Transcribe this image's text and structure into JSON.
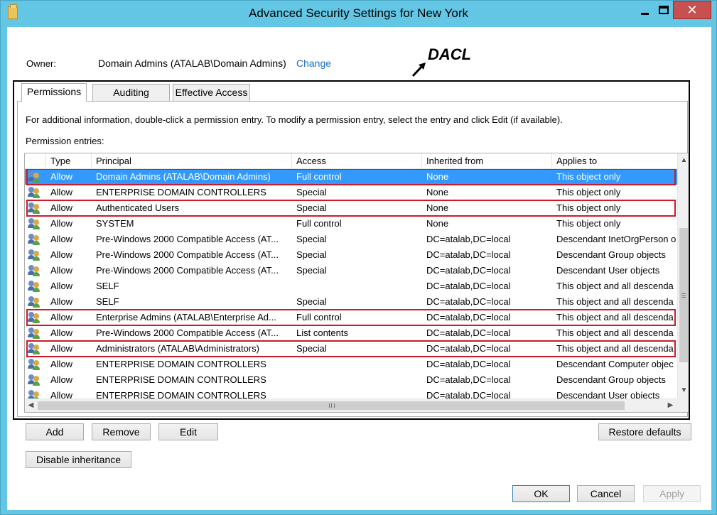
{
  "window": {
    "title": "Advanced Security Settings for New York"
  },
  "owner": {
    "label": "Owner:",
    "value": "Domain Admins (ATALAB\\Domain Admins)",
    "change_link": "Change"
  },
  "annotation": {
    "label": "DACL"
  },
  "tabs": [
    {
      "label": "Permissions",
      "active": true
    },
    {
      "label": "Auditing",
      "active": false
    },
    {
      "label": "Effective Access",
      "active": false
    }
  ],
  "info_text": "For additional information, double-click a permission entry. To modify a permission entry, select the entry and click Edit (if available).",
  "entries_label": "Permission entries:",
  "table": {
    "columns": [
      "Type",
      "Principal",
      "Access",
      "Inherited from",
      "Applies to"
    ],
    "rows": [
      {
        "type": "Allow",
        "principal": "Domain Admins (ATALAB\\Domain Admins)",
        "access": "Full control",
        "inherited": "None",
        "applies": "This object only",
        "selected": true,
        "highlighted": true
      },
      {
        "type": "Allow",
        "principal": "ENTERPRISE DOMAIN CONTROLLERS",
        "access": "Special",
        "inherited": "None",
        "applies": "This object only"
      },
      {
        "type": "Allow",
        "principal": "Authenticated Users",
        "access": "Special",
        "inherited": "None",
        "applies": "This object only",
        "highlighted": true
      },
      {
        "type": "Allow",
        "principal": "SYSTEM",
        "access": "Full control",
        "inherited": "None",
        "applies": "This object only"
      },
      {
        "type": "Allow",
        "principal": "Pre-Windows 2000 Compatible Access (AT...",
        "access": "Special",
        "inherited": "DC=atalab,DC=local",
        "applies": "Descendant InetOrgPerson o"
      },
      {
        "type": "Allow",
        "principal": "Pre-Windows 2000 Compatible Access (AT...",
        "access": "Special",
        "inherited": "DC=atalab,DC=local",
        "applies": "Descendant Group objects"
      },
      {
        "type": "Allow",
        "principal": "Pre-Windows 2000 Compatible Access (AT...",
        "access": "Special",
        "inherited": "DC=atalab,DC=local",
        "applies": "Descendant User objects"
      },
      {
        "type": "Allow",
        "principal": "SELF",
        "access": "",
        "inherited": "DC=atalab,DC=local",
        "applies": "This object and all descenda"
      },
      {
        "type": "Allow",
        "principal": "SELF",
        "access": "Special",
        "inherited": "DC=atalab,DC=local",
        "applies": "This object and all descenda"
      },
      {
        "type": "Allow",
        "principal": "Enterprise Admins (ATALAB\\Enterprise Ad...",
        "access": "Full control",
        "inherited": "DC=atalab,DC=local",
        "applies": "This object and all descenda",
        "highlighted": true
      },
      {
        "type": "Allow",
        "principal": "Pre-Windows 2000 Compatible Access (AT...",
        "access": "List contents",
        "inherited": "DC=atalab,DC=local",
        "applies": "This object and all descenda"
      },
      {
        "type": "Allow",
        "principal": "Administrators (ATALAB\\Administrators)",
        "access": "Special",
        "inherited": "DC=atalab,DC=local",
        "applies": "This object and all descenda",
        "highlighted": true
      },
      {
        "type": "Allow",
        "principal": "ENTERPRISE DOMAIN CONTROLLERS",
        "access": "",
        "inherited": "DC=atalab,DC=local",
        "applies": "Descendant Computer objec"
      },
      {
        "type": "Allow",
        "principal": "ENTERPRISE DOMAIN CONTROLLERS",
        "access": "",
        "inherited": "DC=atalab,DC=local",
        "applies": "Descendant Group objects"
      },
      {
        "type": "Allow",
        "principal": "ENTERPRISE DOMAIN CONTROLLERS",
        "access": "",
        "inherited": "DC=atalab,DC=local",
        "applies": "Descendant User objects"
      }
    ]
  },
  "buttons": {
    "add": "Add",
    "remove": "Remove",
    "edit": "Edit",
    "restore_defaults": "Restore defaults",
    "disable_inheritance": "Disable inheritance",
    "ok": "OK",
    "cancel": "Cancel",
    "apply": "Apply"
  },
  "colors": {
    "title_bar": "#62c6e4",
    "selection": "#3399ff",
    "highlight_box": "#cc1a2a",
    "link": "#1a6fc4",
    "close_button": "#c75050"
  }
}
